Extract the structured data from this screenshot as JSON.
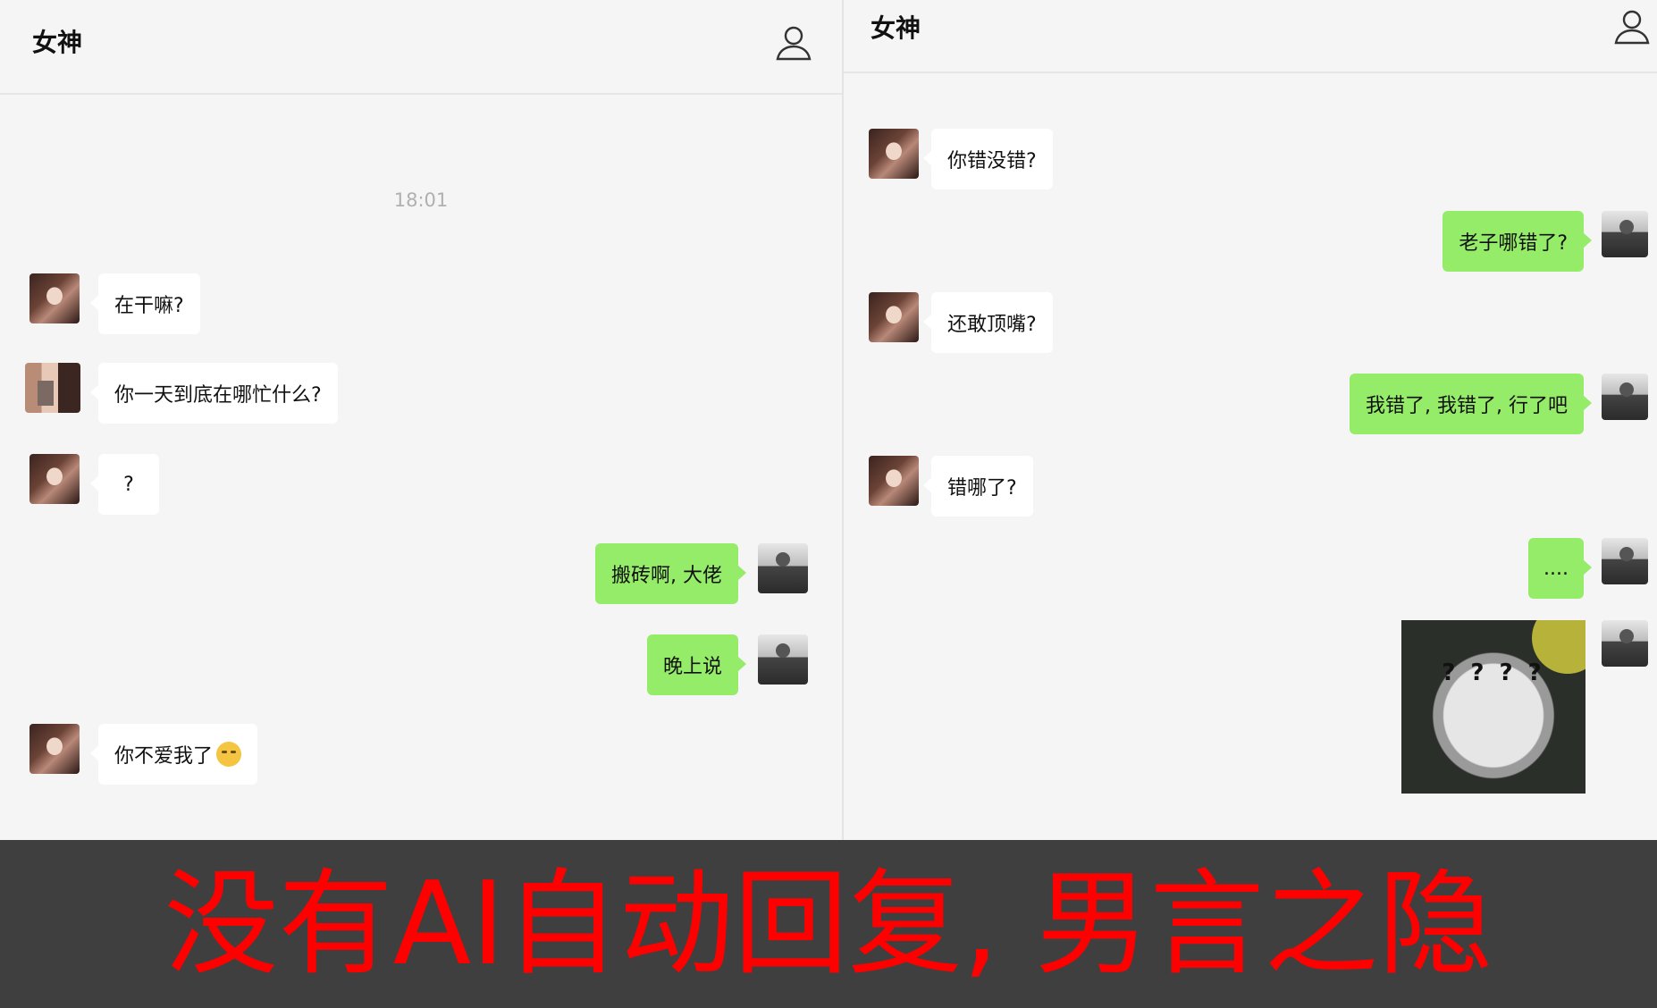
{
  "left_chat": {
    "title": "女神",
    "timestamp": "18:01",
    "messages": [
      {
        "side": "in",
        "text": "在干嘛?"
      },
      {
        "side": "in",
        "text": "你一天到底在哪忙什么?"
      },
      {
        "side": "in",
        "text": "?"
      },
      {
        "side": "out",
        "text": "搬砖啊, 大佬"
      },
      {
        "side": "out",
        "text": "晚上说"
      },
      {
        "side": "in",
        "text": "你不爱我了",
        "emoji": "crying-face-emoji"
      }
    ]
  },
  "right_chat": {
    "title": "女神",
    "messages": [
      {
        "side": "in",
        "text": "你错没错?"
      },
      {
        "side": "out",
        "text": "老子哪错了?"
      },
      {
        "side": "in",
        "text": "还敢顶嘴?"
      },
      {
        "side": "out",
        "text": "我错了, 我错了, 行了吧"
      },
      {
        "side": "in",
        "text": "错哪了?"
      },
      {
        "side": "out",
        "text": "...."
      },
      {
        "side": "out",
        "type": "sticker",
        "text": "? ? ? ?"
      }
    ]
  },
  "caption": "没有AI自动回复, 男言之隐",
  "colors": {
    "outgoing_bubble": "#95ec69",
    "incoming_bubble": "#ffffff",
    "caption": "#ff0000",
    "footer": "#3f3f3f"
  },
  "icons": {
    "profile": "person-outline-icon"
  }
}
